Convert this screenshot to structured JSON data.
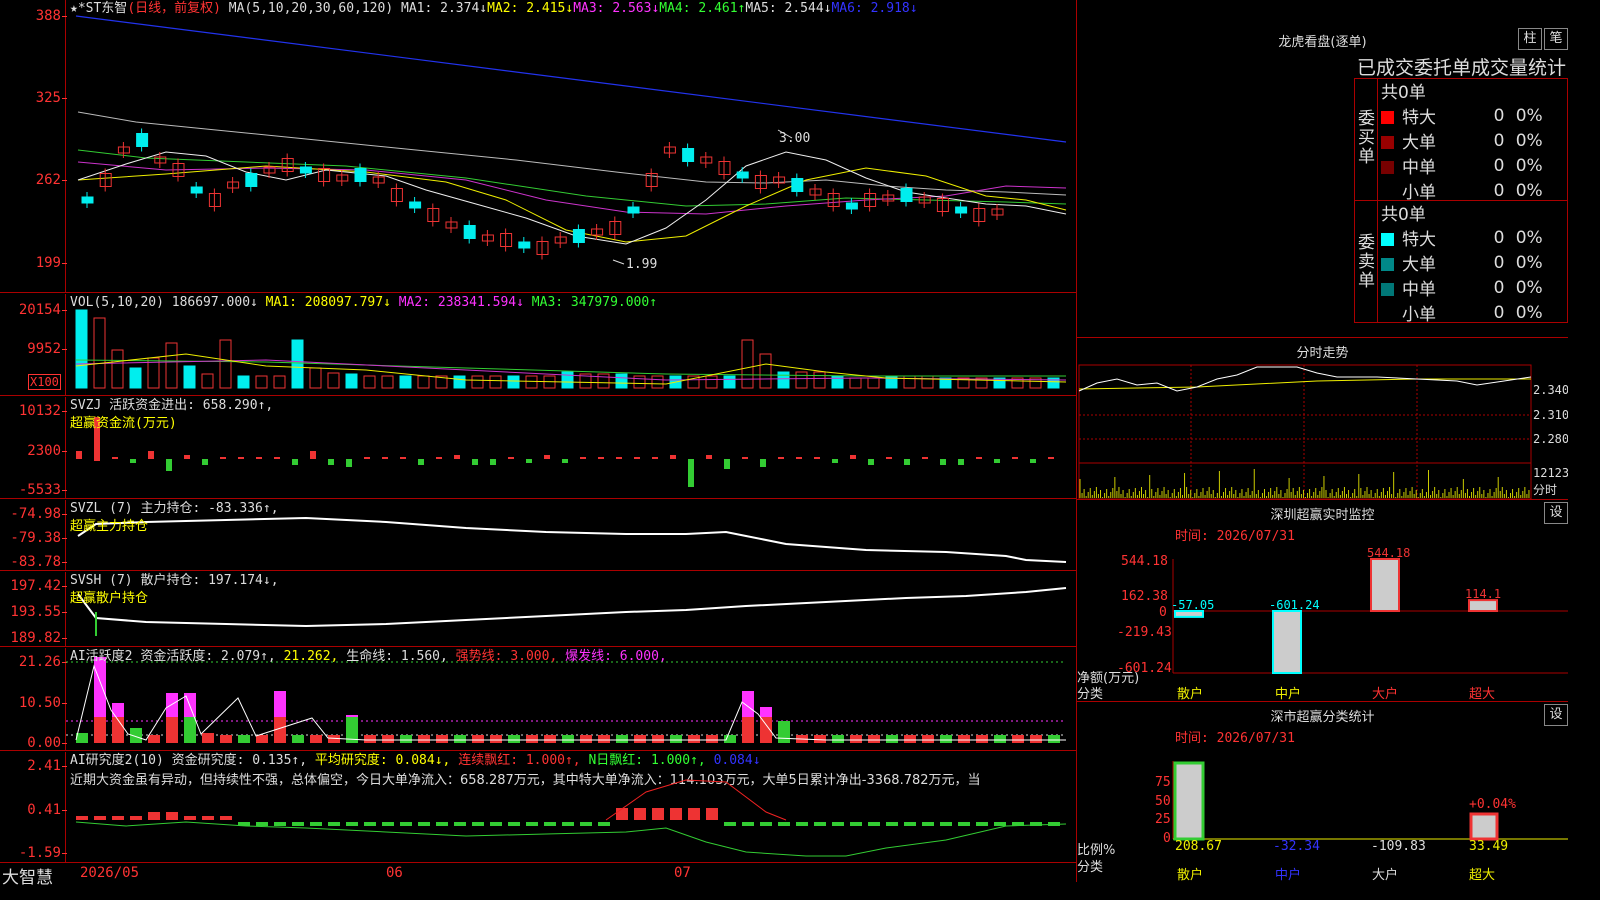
{
  "kline": {
    "title": "★*ST东智",
    "mode": "(日线，前复权)",
    "ma_head": "MA(5,10,20,30,60,120)",
    "ma1": "MA1: 2.374↓",
    "ma2": "MA2: 2.415↓",
    "ma3": "MA3: 2.563↓",
    "ma4": "MA4: 2.461↑",
    "ma5": "MA5: 2.544↓",
    "ma6": "MA6: 2.918↓",
    "yticks": [
      "388",
      "325",
      "262",
      "199"
    ],
    "high_mark": "3.00",
    "low_mark": "1.99"
  },
  "vol": {
    "head": "VOL(5,10,20)",
    "v": "186697.000↓",
    "ma1": "MA1: 208097.797↓",
    "ma2": "MA2: 238341.594↓",
    "ma3": "MA3: 347979.000↑",
    "yticks": [
      "20154",
      "9952"
    ],
    "unit": "X100"
  },
  "svzj": {
    "head": "SVZJ  活跃资金进出: 658.290↑,",
    "sub": "超赢资金流(万元)",
    "yticks": [
      "10132",
      "2300",
      "-5533"
    ]
  },
  "svzl": {
    "head": "SVZL (7) 主力持仓: -83.336↑,",
    "sub": "超赢主力持仓",
    "yticks": [
      "-74.98",
      "-79.38",
      "-83.78"
    ]
  },
  "svsh": {
    "head": "SVSH (7) 散户持仓: 197.174↓,",
    "sub": "超赢散户持仓",
    "yticks": [
      "197.42",
      "193.55",
      "189.82"
    ]
  },
  "ai1": {
    "name": "AI活跃度2",
    "a": "资金活跃度: 2.079↑,",
    "b": "21.262,",
    "c": "生命线: 1.560,",
    "d": "强势线: 3.000,",
    "e": "爆发线: 6.000,",
    "yticks": [
      "21.26",
      "10.50",
      "0.00"
    ]
  },
  "ai2": {
    "name": "AI研究度2(10)",
    "a": "资金研究度: 0.135↑,",
    "b": "平均研究度: 0.084↓,",
    "c": "连续飘红: 1.000↑,",
    "d": "N日飘红: 1.000↑,",
    "e": "0.084↓",
    "comment": "近期大资金虽有异动，但持续性不强，总体偏空，今日大单净流入：658.287万元，其中特大单净流入：114.103万元，大单5日累计净出-3368.782万元，当",
    "yticks": [
      "2.41",
      "0.41",
      "-1.59"
    ]
  },
  "bottom": {
    "brand": "大智慧",
    "d1": "2026/05",
    "d2": "06",
    "d3": "07"
  },
  "lhb": {
    "title": "龙虎看盘(逐单)",
    "b1": "柱",
    "b2": "笔",
    "table_title": "已成交委托单成交量统计",
    "buy_label": "委买单",
    "sell_label": "委卖单",
    "total": "共0单",
    "rows": [
      {
        "name": "特大",
        "v": "0",
        "p": "0%"
      },
      {
        "name": "大单",
        "v": "0",
        "p": "0%"
      },
      {
        "name": "中单",
        "v": "0",
        "p": "0%"
      },
      {
        "name": "小单",
        "v": "0",
        "p": "0%"
      }
    ]
  },
  "tick": {
    "title": "分时走势",
    "y1": "2.340",
    "y2": "2.310",
    "y3": "2.280",
    "vol": "12123",
    "foot": "分时"
  },
  "sz": {
    "title": "深圳超赢实时监控",
    "btn": "设",
    "date": "时间: 2026/07/31",
    "yticks": [
      "544.18",
      "162.38",
      "0",
      "-219.43",
      "-601.24"
    ],
    "unit1": "净额(万元)",
    "unit2": "分类",
    "cats": [
      "散户",
      "中户",
      "大户",
      "超大"
    ],
    "values": [
      -57.05,
      -601.24,
      544.18,
      114.1
    ],
    "labels": [
      "-57.05",
      "-601.24",
      "544.18",
      "114.1"
    ]
  },
  "ss": {
    "title": "深市超赢分类统计",
    "btn": "设",
    "date": "时间: 2026/07/31",
    "yticks": [
      "75",
      "50",
      "25",
      "0"
    ],
    "unit1": "比例%",
    "unit2": "分类",
    "cats": [
      "散户",
      "中户",
      "大户",
      "超大"
    ],
    "labels": [
      "208.67",
      "-32.34",
      "-109.83",
      "33.49"
    ],
    "pct": "+0.04%"
  },
  "chart_data": [
    {
      "type": "bar",
      "title": "深圳超赢实时监控",
      "categories": [
        "散户",
        "中户",
        "大户",
        "超大"
      ],
      "values": [
        -57.05,
        -601.24,
        544.18,
        114.1
      ],
      "ylabel": "净额(万元)",
      "ylim": [
        -601.24,
        544.18
      ]
    },
    {
      "type": "bar",
      "title": "深市超赢分类统计",
      "categories": [
        "散户",
        "中户",
        "大户",
        "超大"
      ],
      "values": [
        208.67,
        -32.34,
        -109.83,
        33.49
      ],
      "ylabel": "比例%",
      "ylim": [
        0,
        75
      ]
    }
  ]
}
